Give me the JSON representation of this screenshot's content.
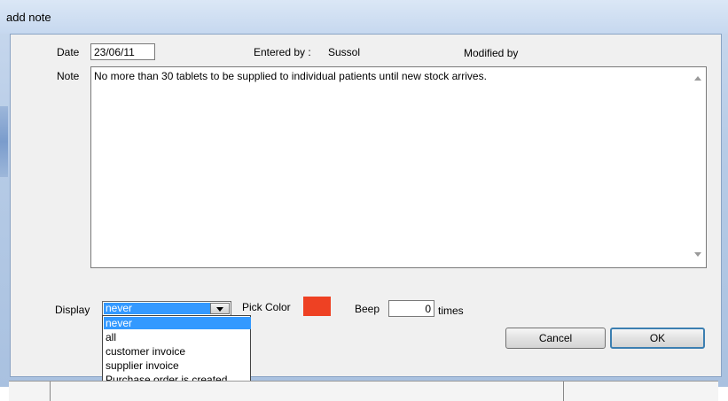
{
  "window": {
    "title": "add note"
  },
  "header": {
    "date_label": "Date",
    "date_value": "23/06/11",
    "entered_by_label": "Entered by :",
    "entered_by_value": "Sussol",
    "modified_by_label": "Modified by"
  },
  "note": {
    "label": "Note",
    "text": "No more than 30 tablets to be supplied to individual patients until new stock arrives."
  },
  "display": {
    "label": "Display",
    "selected": "never",
    "options": [
      "never",
      "all",
      "customer invoice",
      "supplier invoice",
      "Purchase order is created"
    ]
  },
  "pick_color": {
    "label": "Pick Color",
    "color": "#ee4123"
  },
  "beep": {
    "label": "Beep",
    "value": "0",
    "suffix": "times"
  },
  "buttons": {
    "cancel": "Cancel",
    "ok": "OK"
  }
}
